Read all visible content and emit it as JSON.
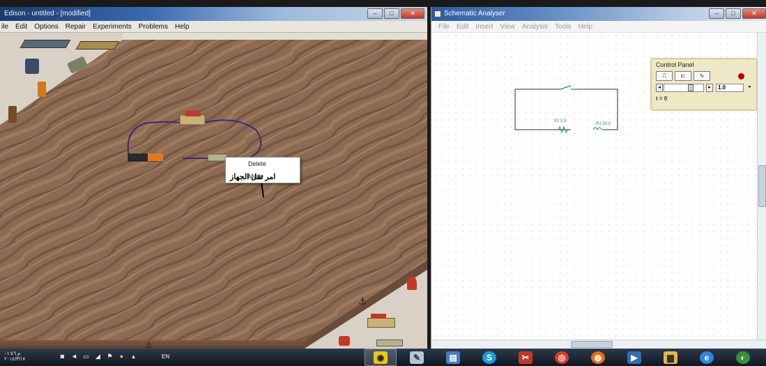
{
  "left_window": {
    "title": "Edison - untitled - [modified]",
    "menu": [
      "ile",
      "Edit",
      "Options",
      "Repair",
      "Experiments",
      "Problems",
      "Help"
    ],
    "context_menu": [
      "Delete",
      "Move"
    ],
    "annotation": "امر نقل الجهاز"
  },
  "right_window": {
    "title": "Schematic Analyser",
    "menu": [
      "File",
      "Edit",
      "Insert",
      "View",
      "Analysis",
      "Tools",
      "Help"
    ],
    "schematic": {
      "source_label": "V1 1.5",
      "resistor_label": "R1 20.0"
    },
    "control_panel": {
      "title": "Control Panel",
      "value": "1.0",
      "time": "t = 0"
    }
  },
  "taskbar": {
    "clock_line1": "م ٠١:٤٦",
    "clock_line2": "٢٠١٤/٣/١٧",
    "language": "EN",
    "apps": [
      "media-icon",
      "paint-icon",
      "notepad-icon",
      "skype-icon",
      "scissors-icon",
      "chrome-icon",
      "firefox-icon",
      "video-icon",
      "folder-icon",
      "ie-icon",
      "globe-icon"
    ]
  },
  "colors": {
    "wood": "#8a6a52",
    "wire": "#3b2a7a",
    "schematic_wire": "#2a2a2a",
    "schematic_green": "#1e8a4a"
  }
}
